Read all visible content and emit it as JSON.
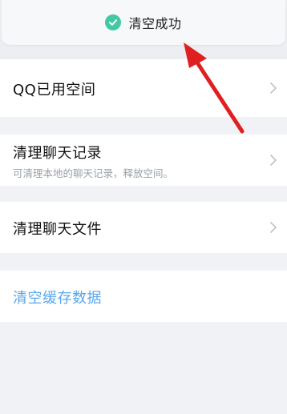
{
  "toast": {
    "icon": "check-circle-icon",
    "text": "清空成功"
  },
  "rows": [
    {
      "title": "QQ已用空间",
      "icon": "chevron-right-icon"
    },
    {
      "title": "清理聊天记录",
      "subtitle": "可清理本地的聊天记录，释放空间。",
      "icon": "chevron-right-icon"
    },
    {
      "title": "清理聊天文件",
      "icon": "chevron-right-icon"
    }
  ],
  "clear_cache": {
    "label": "清空缓存数据"
  },
  "colors": {
    "accent": "#5aa7ea",
    "toast_check": "#43c8a5",
    "annotation_arrow": "#e02020",
    "background": "#f1f2f6"
  }
}
